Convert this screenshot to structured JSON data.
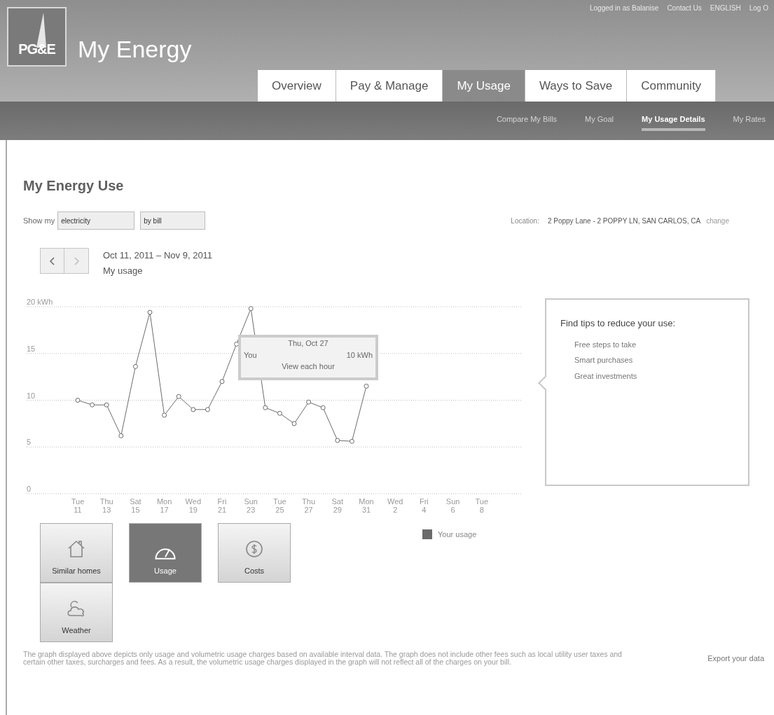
{
  "header": {
    "logo_text": "PG&E",
    "title": "My Energy",
    "top_links": [
      "Logged in as Balanise",
      "Contact Us",
      "ENGLISH",
      "Log O"
    ]
  },
  "nav_tabs": [
    {
      "label": "Overview",
      "selected": false
    },
    {
      "label": "Pay & Manage",
      "selected": false
    },
    {
      "label": "My Usage",
      "selected": true
    },
    {
      "label": "Ways to Save",
      "selected": false
    },
    {
      "label": "Community",
      "selected": false
    }
  ],
  "sub_nav": [
    {
      "label": "Compare My Bills",
      "selected": false
    },
    {
      "label": "My Goal",
      "selected": false
    },
    {
      "label": "My Usage Details",
      "selected": true
    },
    {
      "label": "My Rates",
      "selected": false
    }
  ],
  "page_title": "My Energy Use",
  "filters": {
    "label": "Show my",
    "fuel": "electricity",
    "period": "by bill"
  },
  "location": {
    "label": "Location:",
    "value": "2 Poppy Lane - 2 POPPY LN, SAN CARLOS, CA",
    "action": "change"
  },
  "range": {
    "dates": "Oct 11, 2011 – Nov 9, 2011",
    "subtitle": "My usage"
  },
  "chart": {
    "chart_data": {
      "type": "line",
      "ylim": [
        0,
        20
      ],
      "grid": true,
      "yticks": [
        0,
        5,
        10,
        15,
        {
          "value": 20,
          "label": "20 kWh"
        }
      ],
      "categories": [
        "Tue 11",
        null,
        "Thu 13",
        null,
        "Sat 15",
        null,
        "Mon 17",
        null,
        "Wed 19",
        null,
        "Fri 21",
        null,
        "Sun 23",
        null,
        "Tue 25",
        null,
        "Thu 27",
        null,
        "Sat 29",
        null,
        "Mon 31",
        null,
        "Wed 2",
        null,
        "Fri 4",
        null,
        "Sun 6",
        null,
        "Tue 8",
        null
      ],
      "series": [
        {
          "name": "Your usage",
          "color": "#6b6b6b",
          "marker": "circle",
          "values": [
            10.0,
            9.5,
            9.5,
            6.2,
            13.6,
            19.4,
            8.4,
            10.4,
            9.0,
            9.0,
            12.0,
            16.0,
            19.8,
            9.2,
            8.6,
            7.5,
            9.8,
            9.2,
            5.7,
            5.6,
            11.5,
            null,
            null,
            null,
            null,
            null,
            null,
            null,
            null,
            null
          ]
        }
      ]
    },
    "tooltip": {
      "date": "Thu, Oct 27",
      "series": "You",
      "value": "10 kWh",
      "action": "View each hour"
    }
  },
  "tips": {
    "title": "Find tips to reduce your use:",
    "links": [
      "Free steps to take",
      "Smart purchases",
      "Great investments"
    ]
  },
  "views": [
    {
      "kind": "home",
      "label": "Similar homes",
      "selected": false
    },
    {
      "kind": "gauge",
      "label": "Usage",
      "selected": true
    },
    {
      "kind": "dollar",
      "label": "Costs",
      "selected": false
    },
    {
      "kind": "weather",
      "label": "Weather",
      "selected": false
    }
  ],
  "disclaimer": "The graph displayed above depicts only usage and volumetric usage charges based on available interval data. The graph does not include other fees such as local utility user taxes and certain other taxes, surcharges and fees. As a result, the volumetric usage charges displayed in the graph will not reflect all of the charges on your bill.",
  "export_link": "Export your data"
}
